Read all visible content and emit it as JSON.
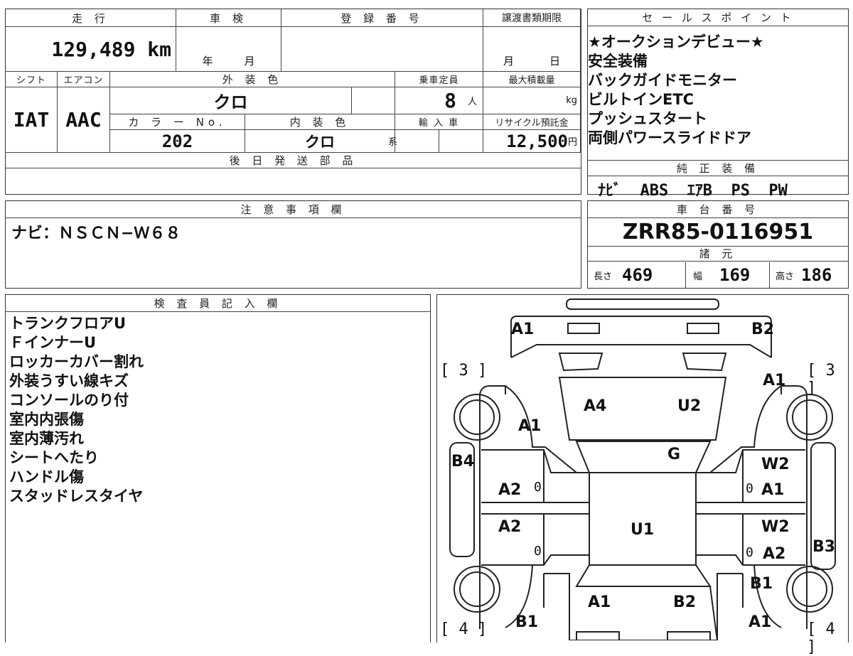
{
  "top_left": {
    "mileage_label": "走 行",
    "mileage_value": "129,489 km",
    "inspection_label": "車 検",
    "inspection_year": "年",
    "inspection_month": "月",
    "registration_label": "登 録 番 号",
    "transfer_label": "譲渡書類期限",
    "transfer_month": "月",
    "transfer_day": "日",
    "shift_label": "シフト",
    "shift_value": "IAT",
    "ac_label": "エアコン",
    "ac_value": "AAC",
    "exterior_color_label": "外 装 色",
    "exterior_color_value": "クロ",
    "capacity_label": "乗車定員",
    "capacity_value": "8",
    "capacity_unit": "人",
    "max_load_label": "最大積載量",
    "max_load_unit": "kg",
    "color_no_label": "カ ラ ー No.",
    "color_no_value": "202",
    "interior_color_label": "内 装 色",
    "interior_color_value": "クロ",
    "interior_color_suffix": "系",
    "import_label": "輸 入 車",
    "recycle_label": "リサイクル預託金",
    "recycle_value": "12,500",
    "recycle_unit": "円",
    "later_parts_label": "後 日 発 送 部 品"
  },
  "sales": {
    "label": "セ ー ル ス ポ イ ン ト",
    "points": [
      "★オークションデビュー★",
      "安全装備",
      "バックガイドモニター",
      "ビルトインETC",
      "プッシュスタート",
      "両側パワースライドドア"
    ]
  },
  "equipment": {
    "label": "純 正 装 備",
    "value": "ﾅﾋﾞ  ABS  ｴｱB  PS  PW"
  },
  "notes": {
    "label": "注 意 事 項 欄",
    "value": "ナビ：ＮＳＣＮ−Ｗ６８"
  },
  "chassis": {
    "label": "車 台 番 号",
    "value": "ZRR85-0116951",
    "specs_label": "諸 元",
    "length_label": "長さ",
    "length_value": "469",
    "width_label": "幅",
    "width_value": "169",
    "height_label": "高さ",
    "height_value": "186"
  },
  "inspector": {
    "label": "検 査 員 記 入 欄",
    "lines": [
      "トランクフロアU",
      "ＦインナーU",
      "ロッカーカバー割れ",
      "外装うすい線キズ",
      "コンソールのり付",
      "室内内張傷",
      "室内薄汚れ",
      "シートへたり",
      "ハンドル傷",
      "スタッドレスタイヤ"
    ]
  },
  "diagram": {
    "tire_front_left": "[ 3 ]",
    "tire_front_right": "[ 3 ]",
    "tire_rear_left": "[ 4 ]",
    "tire_rear_right": "[ 4 ]",
    "marks": {
      "front_left_corner": "A1",
      "front_right_corner": "B2",
      "right_fender": "A1",
      "hood_left": "A4",
      "hood_right": "U2",
      "left_fender": "A1",
      "windshield": "G",
      "left_pillar": "B4",
      "right_door_front_1": "W2",
      "right_door_front_2": "A1",
      "left_door_front": "A2",
      "left_door_rear": "A2",
      "roof": "U1",
      "right_door_rear_1": "W2",
      "right_door_rear_2": "A2",
      "right_quarter": "B3",
      "right_rear_fender": "B1",
      "rear_left": "A1",
      "rear_right": "B2",
      "left_rear_fender": "B1",
      "right_rear_corner": "A1",
      "zero": "0"
    }
  }
}
